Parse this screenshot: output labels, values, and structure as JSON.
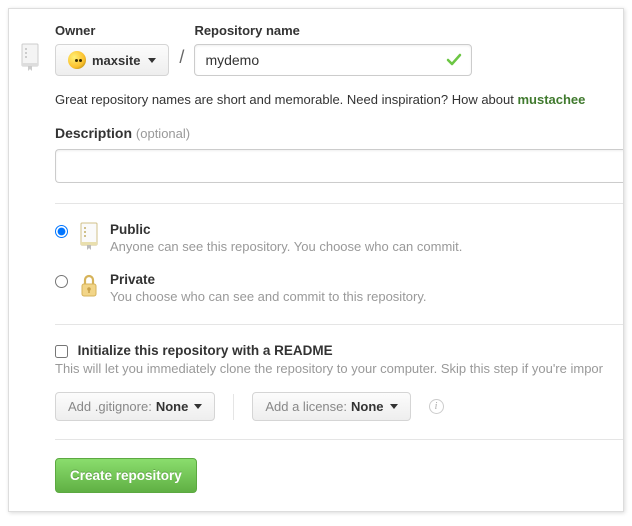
{
  "labels": {
    "owner": "Owner",
    "repo_name": "Repository name",
    "description_label": "Description",
    "description_optional": "(optional)"
  },
  "owner": {
    "name": "maxsite"
  },
  "repo": {
    "name_value": "mydemo"
  },
  "hint": {
    "text_prefix": "Great repository names are short and memorable. Need inspiration? How about ",
    "suggestion": "mustachee"
  },
  "description_value": "",
  "visibility": {
    "public": {
      "title": "Public",
      "sub": "Anyone can see this repository. You choose who can commit.",
      "selected": true
    },
    "private": {
      "title": "Private",
      "sub": "You choose who can see and commit to this repository.",
      "selected": false
    }
  },
  "initialize": {
    "title": "Initialize this repository with a README",
    "sub": "This will let you immediately clone the repository to your computer. Skip this step if you're impor",
    "checked": false
  },
  "dropdowns": {
    "gitignore_prefix": "Add .gitignore: ",
    "gitignore_value": "None",
    "license_prefix": "Add a license: ",
    "license_value": "None"
  },
  "buttons": {
    "create": "Create repository"
  }
}
